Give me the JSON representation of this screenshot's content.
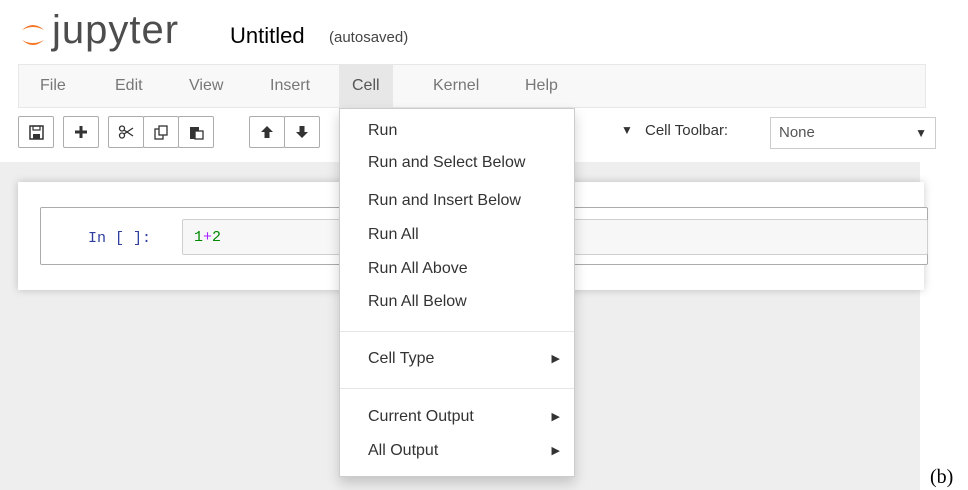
{
  "header": {
    "logo_text": "jupyter",
    "notebook_title": "Untitled",
    "autosave_status": "(autosaved)"
  },
  "menubar": {
    "items": [
      "File",
      "Edit",
      "View",
      "Insert",
      "Cell",
      "Kernel",
      "Help"
    ],
    "active": "Cell"
  },
  "toolbar": {
    "icons": [
      "save-icon",
      "plus-icon",
      "scissors-icon",
      "copy-icon",
      "paste-icon",
      "arrow-up-icon",
      "arrow-down-icon"
    ],
    "celltoolbar_label": "Cell Toolbar:",
    "celltoolbar_value": "None"
  },
  "cell": {
    "prompt": "In [ ]:",
    "code": {
      "left": "1",
      "op": "+",
      "right": "2"
    }
  },
  "cell_menu": {
    "items": [
      {
        "label": "Run"
      },
      {
        "label": "Run and Select Below"
      },
      {
        "label": "Run and Insert Below"
      },
      {
        "label": "Run All"
      },
      {
        "label": "Run All Above"
      },
      {
        "label": "Run All Below"
      },
      {
        "label": "Cell Type",
        "submenu": true
      },
      {
        "label": "Current Output",
        "submenu": true
      },
      {
        "label": "All Output",
        "submenu": true
      }
    ]
  },
  "figure_label": "(b)",
  "colors": {
    "logo_orange": "#f37726",
    "menubar_bg": "#f8f8f8",
    "active_menu_bg": "#e7e7e7",
    "notebook_bg": "#eeeeee",
    "prompt_blue": "#303f9f",
    "code_number": "#008800",
    "code_operator": "#aa22ff"
  }
}
